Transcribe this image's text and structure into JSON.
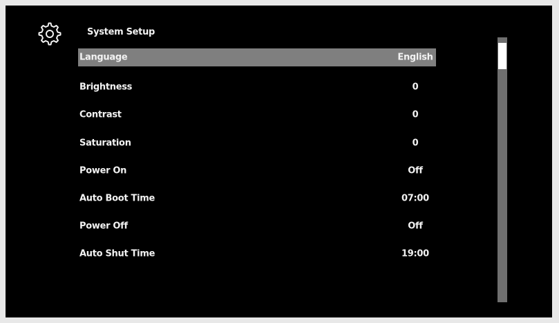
{
  "header": {
    "title": "System Setup",
    "icon": "gear-icon"
  },
  "menu": {
    "items": [
      {
        "label": "Language",
        "value": "English",
        "selected": true
      },
      {
        "label": "Brightness",
        "value": "0"
      },
      {
        "label": "Contrast",
        "value": "0"
      },
      {
        "label": "Saturation",
        "value": "0"
      },
      {
        "label": "Power On",
        "value": "Off"
      },
      {
        "label": "Auto Boot Time",
        "value": "07:00"
      },
      {
        "label": "Power Off",
        "value": "Off"
      },
      {
        "label": "Auto Shut Time",
        "value": "19:00"
      }
    ]
  },
  "colors": {
    "background": "#000000",
    "text": "#f2f2f2",
    "selected_row": "#7f7f7f",
    "scrollbar_track": "#6f6f6f",
    "scrollbar_thumb": "#ffffff"
  }
}
